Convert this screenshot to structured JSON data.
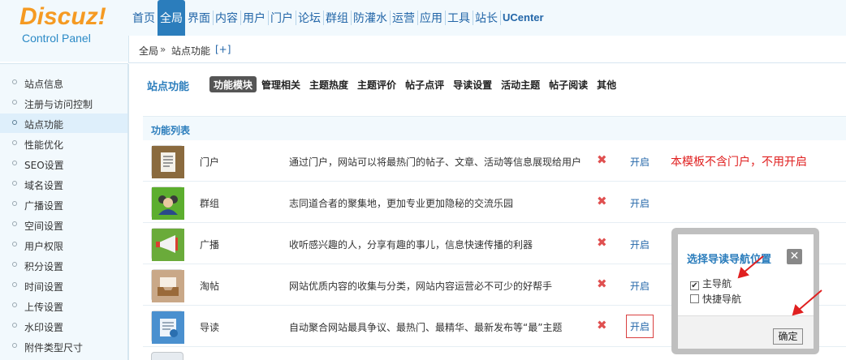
{
  "logo": {
    "brand": "Discuz!",
    "subtitle": "Control Panel"
  },
  "topnav": [
    {
      "label": "首页"
    },
    {
      "label": "全局"
    },
    {
      "label": "界面"
    },
    {
      "label": "内容"
    },
    {
      "label": "用户"
    },
    {
      "label": "门户"
    },
    {
      "label": "论坛"
    },
    {
      "label": "群组"
    },
    {
      "label": "防灌水"
    },
    {
      "label": "运营"
    },
    {
      "label": "应用"
    },
    {
      "label": "工具"
    },
    {
      "label": "站长"
    },
    {
      "label": "UCenter"
    }
  ],
  "breadcrumb": {
    "root": "全局",
    "sep": "»",
    "current": "站点功能",
    "add": "[+]"
  },
  "sidebar": [
    {
      "label": "站点信息"
    },
    {
      "label": "注册与访问控制"
    },
    {
      "label": "站点功能"
    },
    {
      "label": "性能优化"
    },
    {
      "label": "SEO设置"
    },
    {
      "label": "域名设置"
    },
    {
      "label": "广播设置"
    },
    {
      "label": "空间设置"
    },
    {
      "label": "用户权限"
    },
    {
      "label": "积分设置"
    },
    {
      "label": "时间设置"
    },
    {
      "label": "上传设置"
    },
    {
      "label": "水印设置"
    },
    {
      "label": "附件类型尺寸"
    }
  ],
  "main": {
    "title": "站点功能",
    "tabs": [
      {
        "label": "功能模块"
      },
      {
        "label": "管理相关"
      },
      {
        "label": "主题热度"
      },
      {
        "label": "主题评价"
      },
      {
        "label": "帖子点评"
      },
      {
        "label": "导读设置"
      },
      {
        "label": "活动主题"
      },
      {
        "label": "帖子阅读"
      },
      {
        "label": "其他"
      }
    ],
    "section": "功能列表",
    "rows": [
      {
        "name": "门户",
        "desc": "通过门户，网站可以将最热门的帖子、文章、活动等信息展现给用户",
        "status": "✖",
        "action": "开启"
      },
      {
        "name": "群组",
        "desc": "志同道合者的聚集地，更加专业更加隐秘的交流乐园",
        "status": "✖",
        "action": "开启"
      },
      {
        "name": "广播",
        "desc": "收听感兴趣的人，分享有趣的事儿，信息快速传播的利器",
        "status": "✖",
        "action": "开启"
      },
      {
        "name": "淘帖",
        "desc": "网站优质内容的收集与分类，网站内容运营必不可少的好帮手",
        "status": "✖",
        "action": "开启"
      },
      {
        "name": "导读",
        "desc": "自动聚合网站最具争议、最热门、最精华、最新发布等“最”主题",
        "status": "✖",
        "action": "开启"
      }
    ],
    "note": "本模板不含门户，不用开启"
  },
  "popup": {
    "title": "选择导读导航位置",
    "close": "✕",
    "options": [
      {
        "label": "主导航",
        "checked": "✔"
      },
      {
        "label": "快捷导航",
        "checked": ""
      }
    ],
    "ok": "确定"
  },
  "colors": {
    "accent": "#2b7dbc",
    "brand": "#f59a22",
    "alert": "#e02020"
  }
}
